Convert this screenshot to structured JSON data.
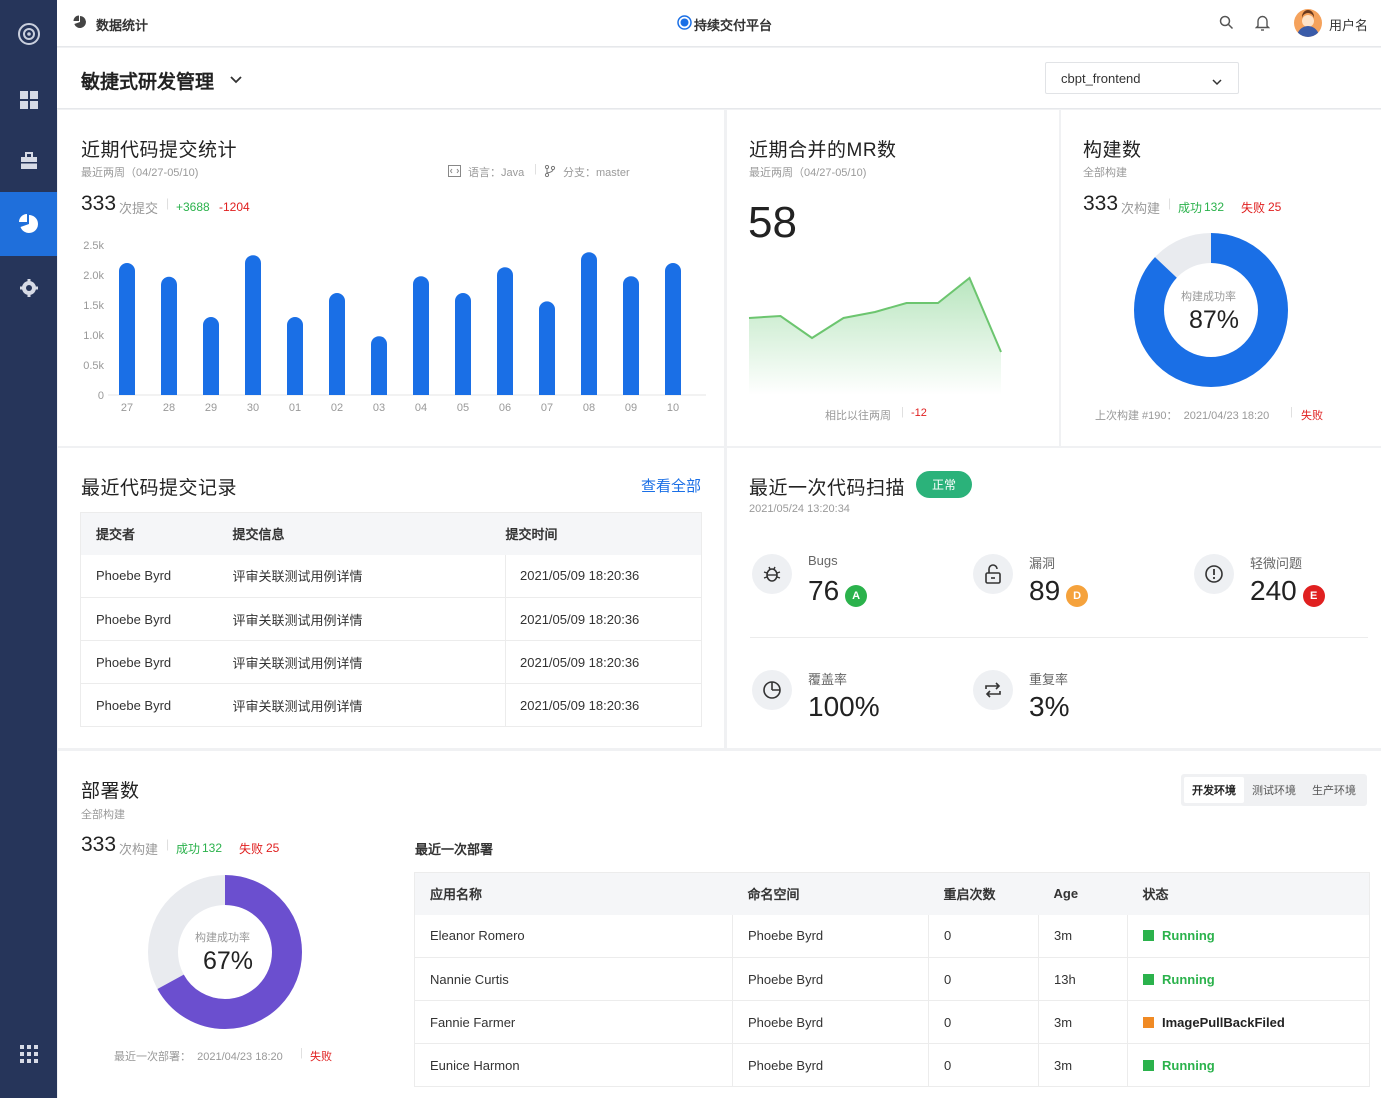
{
  "topbar": {
    "section_title": "数据统计",
    "platform_name": "持续交付平台",
    "user_name": "用户名"
  },
  "subbar": {
    "project_title": "敏捷式研发管理",
    "repo_select": "cbpt_frontend"
  },
  "commit_stats": {
    "title": "近期代码提交统计",
    "period": "最近两周（04/27-05/10)",
    "language": "语言：Java",
    "branch": "分支：master",
    "count": "333",
    "count_unit": "次提交",
    "added": "+3688",
    "removed": "-1204"
  },
  "chart_data": {
    "type": "bar",
    "categories": [
      "27",
      "28",
      "29",
      "30",
      "01",
      "02",
      "03",
      "04",
      "05",
      "06",
      "07",
      "08",
      "09",
      "10"
    ],
    "values": [
      2200,
      1970,
      1300,
      2330,
      1300,
      1700,
      980,
      1980,
      1700,
      2130,
      1560,
      2380,
      1980,
      2200
    ],
    "yticks": [
      "2.5k",
      "2.0k",
      "1.5k",
      "1.0k",
      "0.5k",
      "0"
    ],
    "ylim": [
      0,
      2500
    ],
    "bar_color": "#1a6fe6"
  },
  "mr_stats": {
    "title": "近期合并的MR数",
    "period": "最近两周（04/27-05/10)",
    "count": "58",
    "compare_label": "相比以往两周",
    "compare_value": "-12",
    "trend": [
      2,
      4,
      -18,
      2,
      8,
      17,
      17,
      42,
      -32
    ]
  },
  "build_stats": {
    "title": "构建数",
    "subtitle": "全部构建",
    "count": "333",
    "count_unit": "次构建",
    "success_label": "成功",
    "success": "132",
    "fail_label": "失败",
    "fail": "25",
    "rate_label": "构建成功率",
    "rate": "87%",
    "rate_value": 0.87,
    "last_build": "上次构建 #190：  2021/04/23 18:20",
    "last_status": "失败",
    "ring_color": "#1a6fe6"
  },
  "commit_log": {
    "title": "最近代码提交记录",
    "view_all": "查看全部",
    "columns": [
      "提交者",
      "提交信息",
      "提交时间"
    ],
    "rows": [
      [
        "Phoebe Byrd",
        "评审关联测试用例详情",
        "2021/05/09 18:20:36"
      ],
      [
        "Phoebe Byrd",
        "评审关联测试用例详情",
        "2021/05/09 18:20:36"
      ],
      [
        "Phoebe Byrd",
        "评审关联测试用例详情",
        "2021/05/09 18:20:36"
      ],
      [
        "Phoebe Byrd",
        "评审关联测试用例详情",
        "2021/05/09 18:20:36"
      ]
    ]
  },
  "scan": {
    "title": "最近一次代码扫描",
    "status": "正常",
    "time": "2021/05/24 13:20:34",
    "bugs_label": "Bugs",
    "bugs": "76",
    "bugs_grade": "A",
    "vuln_label": "漏洞",
    "vuln": "89",
    "vuln_grade": "D",
    "minor_label": "轻微问题",
    "minor": "240",
    "minor_grade": "E",
    "coverage_label": "覆盖率",
    "coverage": "100%",
    "dup_label": "重复率",
    "dup": "3%"
  },
  "deploy": {
    "title": "部署数",
    "subtitle": "全部构建",
    "count": "333",
    "count_unit": "次构建",
    "success_label": "成功",
    "success": "132",
    "fail_label": "失败",
    "fail": "25",
    "rate_label": "构建成功率",
    "rate": "67%",
    "rate_value": 0.67,
    "last_deploy": "最近一次部署：  2021/04/23 18:20",
    "last_status": "失败",
    "ring_color": "#6b4fcf",
    "tabs": [
      "开发环境",
      "测试环境",
      "生产环境"
    ],
    "recent_label": "最近一次部署",
    "columns": [
      "应用名称",
      "命名空间",
      "重启次数",
      "Age",
      "状态"
    ],
    "rows": [
      [
        "Eleanor Romero",
        "Phoebe Byrd",
        "0",
        "3m",
        "Running"
      ],
      [
        "Nannie Curtis",
        "Phoebe Byrd",
        "0",
        "13h",
        "Running"
      ],
      [
        "Fannie Farmer",
        "Phoebe Byrd",
        "0",
        "3m",
        "ImagePullBackFiled"
      ],
      [
        "Eunice Harmon",
        "Phoebe Byrd",
        "0",
        "3m",
        "Running"
      ]
    ],
    "status_colors": [
      "#2bb24c",
      "#2bb24c",
      "#f08a24",
      "#2bb24c"
    ]
  }
}
